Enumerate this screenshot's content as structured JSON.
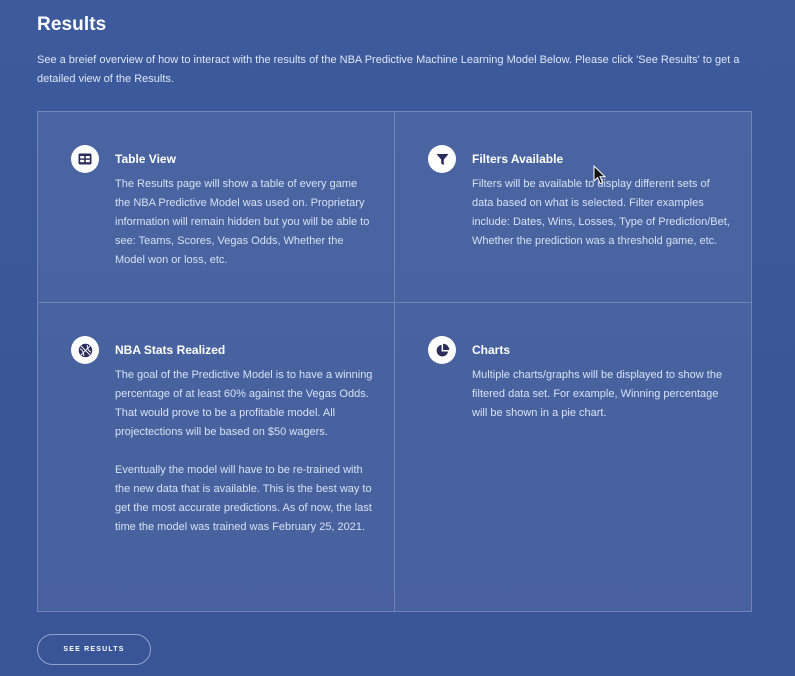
{
  "page": {
    "title": "Results",
    "intro": "See a breief overview of how to interact with the results of the NBA Predictive Machine Learning Model Below. Please click 'See Results' to get a detailed view of the Results."
  },
  "cards": [
    {
      "icon": "table-icon",
      "title": "Table View",
      "paragraphs": [
        "The Results page will show a table of every game the NBA Predictive Model was used on. Proprietary information will remain hidden but you will be able to see: Teams, Scores, Vegas Odds, Whether the Model won or loss, etc."
      ]
    },
    {
      "icon": "filter-icon",
      "title": "Filters Available",
      "paragraphs": [
        "Filters will be available to display different sets of data based on what is selected. Filter examples include: Dates, Wins, Losses, Type of Prediction/Bet, Whether the prediction was a threshold game, etc."
      ]
    },
    {
      "icon": "basketball-icon",
      "title": "NBA Stats Realized",
      "paragraphs": [
        "The goal of the Predictive Model is to have a winning percentage of at least 60% against the Vegas Odds. That would prove to be a profitable model. All projectections will be based on $50 wagers.",
        "Eventually the model will have to be re-trained with the new data that is available. This is the best way to get the most accurate predictions. As of now, the last time the model was trained was February 25, 2021."
      ]
    },
    {
      "icon": "pie-chart-icon",
      "title": "Charts",
      "paragraphs": [
        "Multiple charts/graphs will be displayed to show the filtered data set. For example, Winning percentage will be shown in a pie chart."
      ]
    }
  ],
  "actions": {
    "see_results_label": "SEE RESULTS"
  },
  "colors": {
    "background": "#3a5699",
    "icon_glyph": "#2b2d5c",
    "text_muted": "#d9e1f2"
  }
}
